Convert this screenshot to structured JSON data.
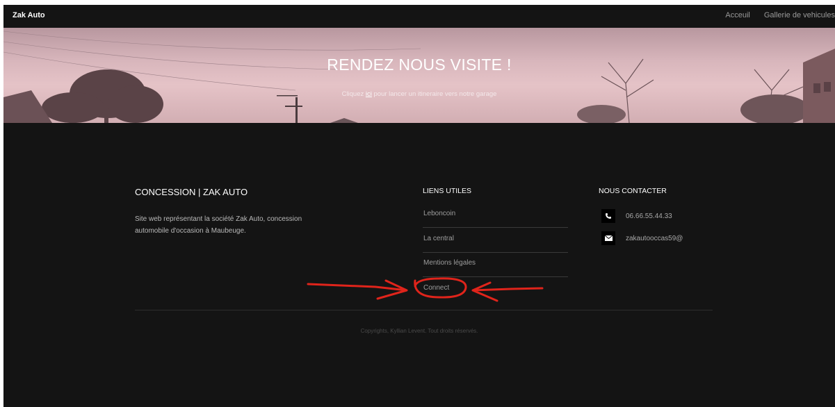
{
  "navbar": {
    "brand": "Zak Auto",
    "links": [
      "Acceuil",
      "Gallerie de vehicules"
    ]
  },
  "hero": {
    "title": "RENDEZ NOUS VISITE !",
    "subtitle_before": "Cliquez ",
    "subtitle_link": "ici",
    "subtitle_after": " pour lancer un itineraire vers notre garage"
  },
  "footer": {
    "about": {
      "title": "CONCESSION | ZAK AUTO",
      "text": "Site web représentant la société Zak Auto, concession automobile d'occasion à Maubeuge."
    },
    "links": {
      "title": "LIENS UTILES",
      "items": [
        "Leboncoin",
        "La central",
        "Mentions légales",
        "Connect"
      ]
    },
    "contact": {
      "title": "NOUS CONTACTER",
      "phone_icon": "phone-icon",
      "phone": "06.66.55.44.33",
      "email_icon": "envelope-icon",
      "email": "zakautooccas59@"
    },
    "copyright": "Copyrights, Kyllian Levent. Tout droits réservés."
  },
  "colors": {
    "background": "#141414",
    "hero_tint": "#e5c3c7",
    "annotation": "#e0241b"
  }
}
